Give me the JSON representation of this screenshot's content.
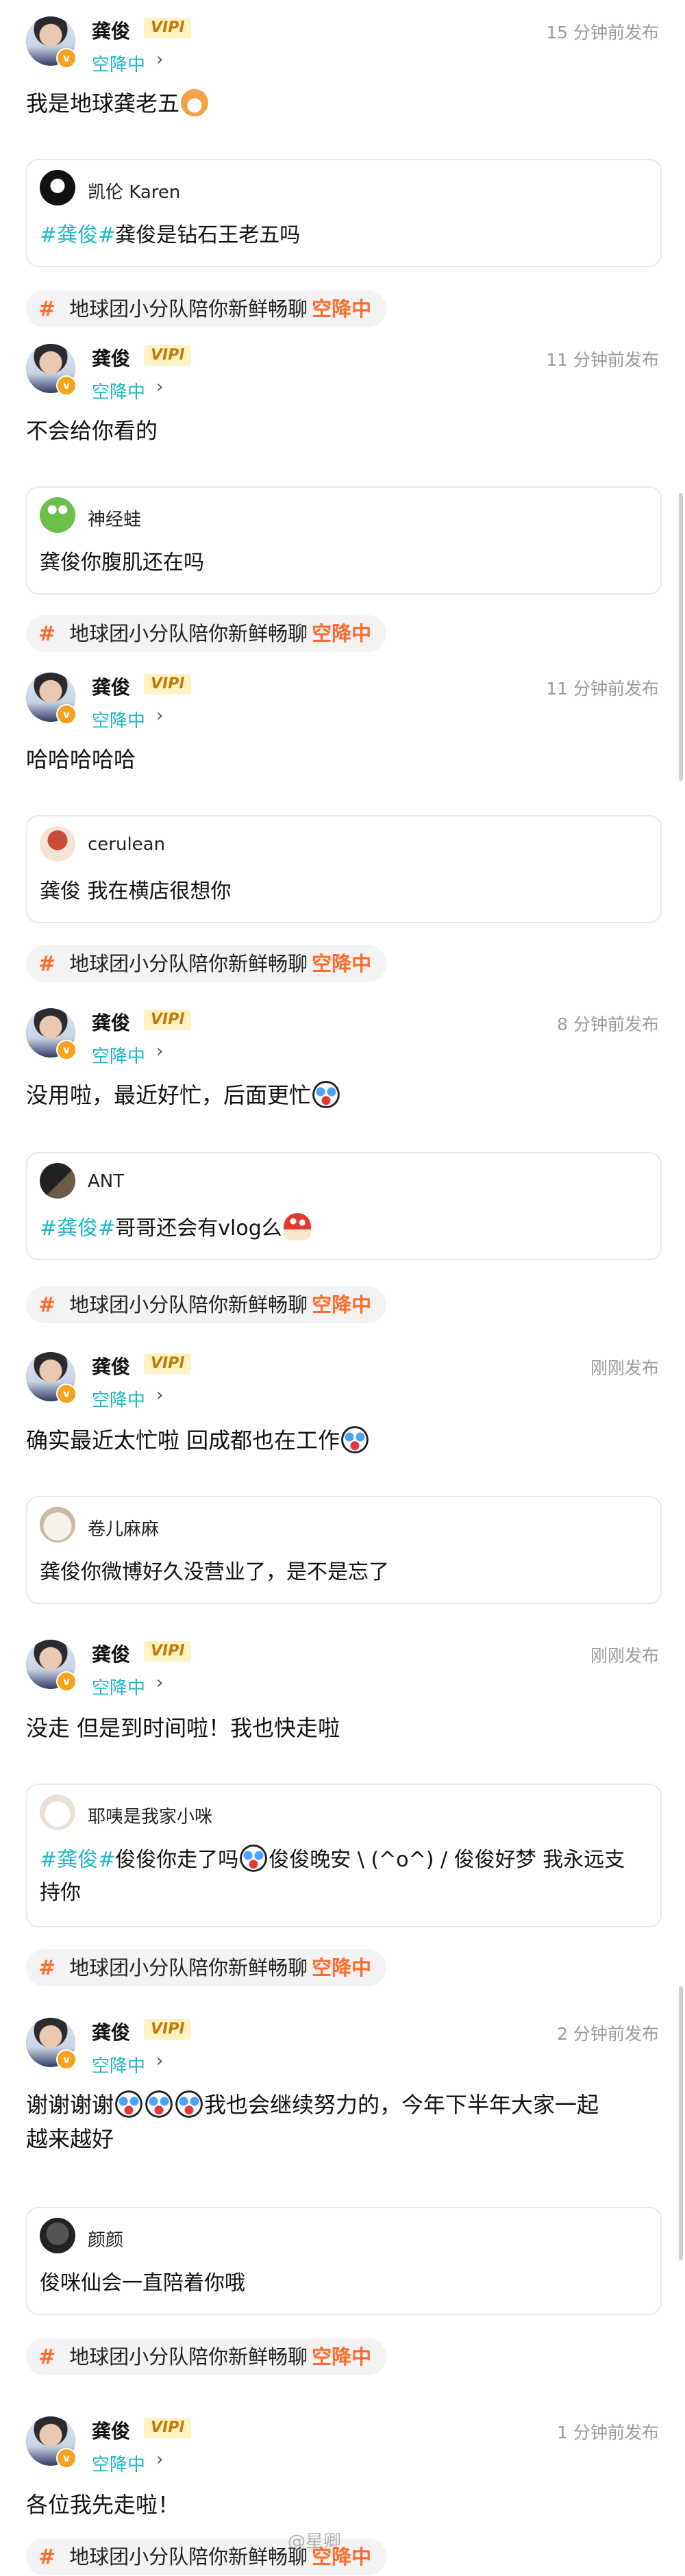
{
  "watermark": "@星卿",
  "posts": [
    {
      "user": "龚俊",
      "vip": "VIPl",
      "status": "空降中",
      "time": "15 分钟前发布",
      "text": "我是地球龚老五",
      "comment": {
        "user": "凯伦 Karen",
        "tag": "#龚俊#",
        "text": "龚俊是钻石王老五吗"
      },
      "topic": {
        "text": "地球团小分队陪你新鲜畅聊",
        "suffix": "空降中"
      }
    },
    {
      "user": "龚俊",
      "vip": "VIPl",
      "status": "空降中",
      "time": "11 分钟前发布",
      "text": "不会给你看的",
      "comment": {
        "user": "神经蛙",
        "tag": "",
        "text": "龚俊你腹肌还在吗"
      },
      "topic": {
        "text": "地球团小分队陪你新鲜畅聊",
        "suffix": "空降中"
      }
    },
    {
      "user": "龚俊",
      "vip": "VIPl",
      "status": "空降中",
      "time": "11 分钟前发布",
      "text": "哈哈哈哈哈",
      "comment": {
        "user": "cerulean",
        "tag": "",
        "text": "龚俊 我在横店很想你"
      },
      "topic": {
        "text": "地球团小分队陪你新鲜畅聊",
        "suffix": "空降中"
      }
    },
    {
      "user": "龚俊",
      "vip": "VIPl",
      "status": "空降中",
      "time": "8 分钟前发布",
      "text": "没用啦，最近好忙，后面更忙",
      "comment": {
        "user": "ANT",
        "tag": "#龚俊#",
        "text": "哥哥还会有vlog么"
      },
      "topic": {
        "text": "地球团小分队陪你新鲜畅聊",
        "suffix": "空降中"
      }
    },
    {
      "user": "龚俊",
      "vip": "VIPl",
      "status": "空降中",
      "time": "刚刚发布",
      "text": "确实最近太忙啦 回成都也在工作",
      "comment": {
        "user": "卷儿麻麻",
        "tag": "",
        "text": "龚俊你微博好久没营业了，是不是忘了"
      }
    },
    {
      "user": "龚俊",
      "vip": "VIPl",
      "status": "空降中",
      "time": "刚刚发布",
      "text": "没走 但是到时间啦！我也快走啦",
      "comment": {
        "user": "耶咦是我家小咪",
        "tag": "#龚俊#",
        "text": "俊俊你走了吗",
        "text2": "俊俊晚安 \\ (^o^) / 俊俊好梦 我永远支",
        "text3": "持你"
      },
      "topic": {
        "text": "地球团小分队陪你新鲜畅聊",
        "suffix": "空降中"
      }
    },
    {
      "user": "龚俊",
      "vip": "VIPl",
      "status": "空降中",
      "time": "2 分钟前发布",
      "text": "谢谢谢谢",
      "text_after": "我也会继续努力的，今年下半年大家一起",
      "text_line2": "越来越好",
      "comment": {
        "user": "颜颜",
        "tag": "",
        "text": "俊咪仙会一直陪着你哦"
      },
      "topic": {
        "text": "地球团小分队陪你新鲜畅聊",
        "suffix": "空降中"
      }
    },
    {
      "user": "龚俊",
      "vip": "VIPl",
      "status": "空降中",
      "time": "1 分钟前发布",
      "text": "各位我先走啦！",
      "topic": {
        "text": "地球团小分队陪你新鲜畅聊",
        "suffix": "空降中"
      }
    }
  ]
}
